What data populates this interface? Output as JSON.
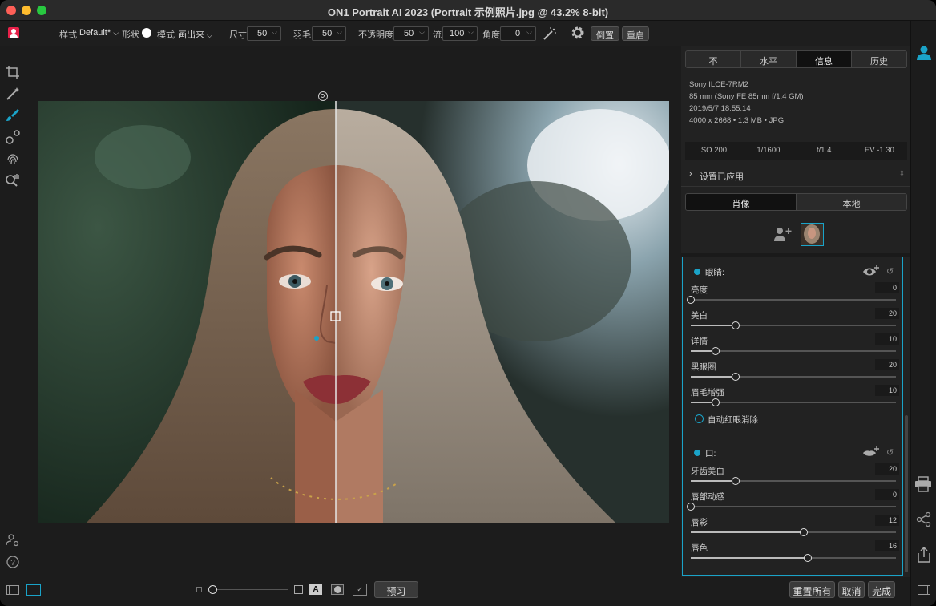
{
  "window": {
    "title": "ON1 Portrait AI 2023 (Portrait 示例照片.jpg @ 43.2% 8-bit)"
  },
  "toolbar": {
    "style_label": "样式",
    "style_value": "Default*",
    "shape_label": "形状",
    "mode_label": "模式",
    "mode_value": "画出来",
    "size_label": "尺寸",
    "size_value": "50",
    "feather_label": "羽毛",
    "feather_value": "50",
    "opacity_label": "不透明度",
    "opacity_value": "50",
    "flow_label": "流",
    "flow_value": "100",
    "angle_label": "角度",
    "angle_value": "0",
    "invert_button": "倒置",
    "reset_button": "重启"
  },
  "panel": {
    "tabs": [
      {
        "label": "不",
        "active": false
      },
      {
        "label": "水平",
        "active": false
      },
      {
        "label": "信息",
        "active": true
      },
      {
        "label": "历史",
        "active": false
      }
    ],
    "info": {
      "camera": "Sony ILCE-7RM2",
      "lens": "85 mm (Sony FE 85mm f/1.4 GM)",
      "datetime": "2019/5/7  18:55:14",
      "file": "4000 x 2668 • 1.3 MB • JPG"
    },
    "exif": {
      "iso": "ISO 200",
      "shutter": "1/1600",
      "aperture": "f/1.4",
      "ev": "EV -1.30"
    },
    "settings_applied": "设置已应用",
    "mode_tabs": [
      {
        "label": "肖像",
        "active": true
      },
      {
        "label": "本地",
        "active": false
      }
    ],
    "eyes": {
      "title": "眼睛:",
      "sliders": [
        {
          "label": "亮度",
          "value": "0",
          "pos": 0
        },
        {
          "label": "美白",
          "value": "20",
          "pos": 0.22
        },
        {
          "label": "详情",
          "value": "10",
          "pos": 0.12
        },
        {
          "label": "黑眼圈",
          "value": "20",
          "pos": 0.22
        },
        {
          "label": "眉毛增强",
          "value": "10",
          "pos": 0.12
        }
      ],
      "auto_redeye": "自动红眼消除"
    },
    "mouth": {
      "title": "口:",
      "sliders": [
        {
          "label": "牙齿美白",
          "value": "20",
          "pos": 0.22
        },
        {
          "label": "唇部动感",
          "value": "0",
          "pos": 0
        },
        {
          "label": "唇彩",
          "value": "12",
          "pos": 0.55
        },
        {
          "label": "唇色",
          "value": "16",
          "pos": 0.57
        }
      ]
    }
  },
  "bottom": {
    "preview_button": "预习",
    "reset_all_button": "重置所有",
    "cancel_button": "取消",
    "done_button": "完成"
  },
  "colors": {
    "accent": "#1aa3c8",
    "brand": "#e8214a"
  }
}
